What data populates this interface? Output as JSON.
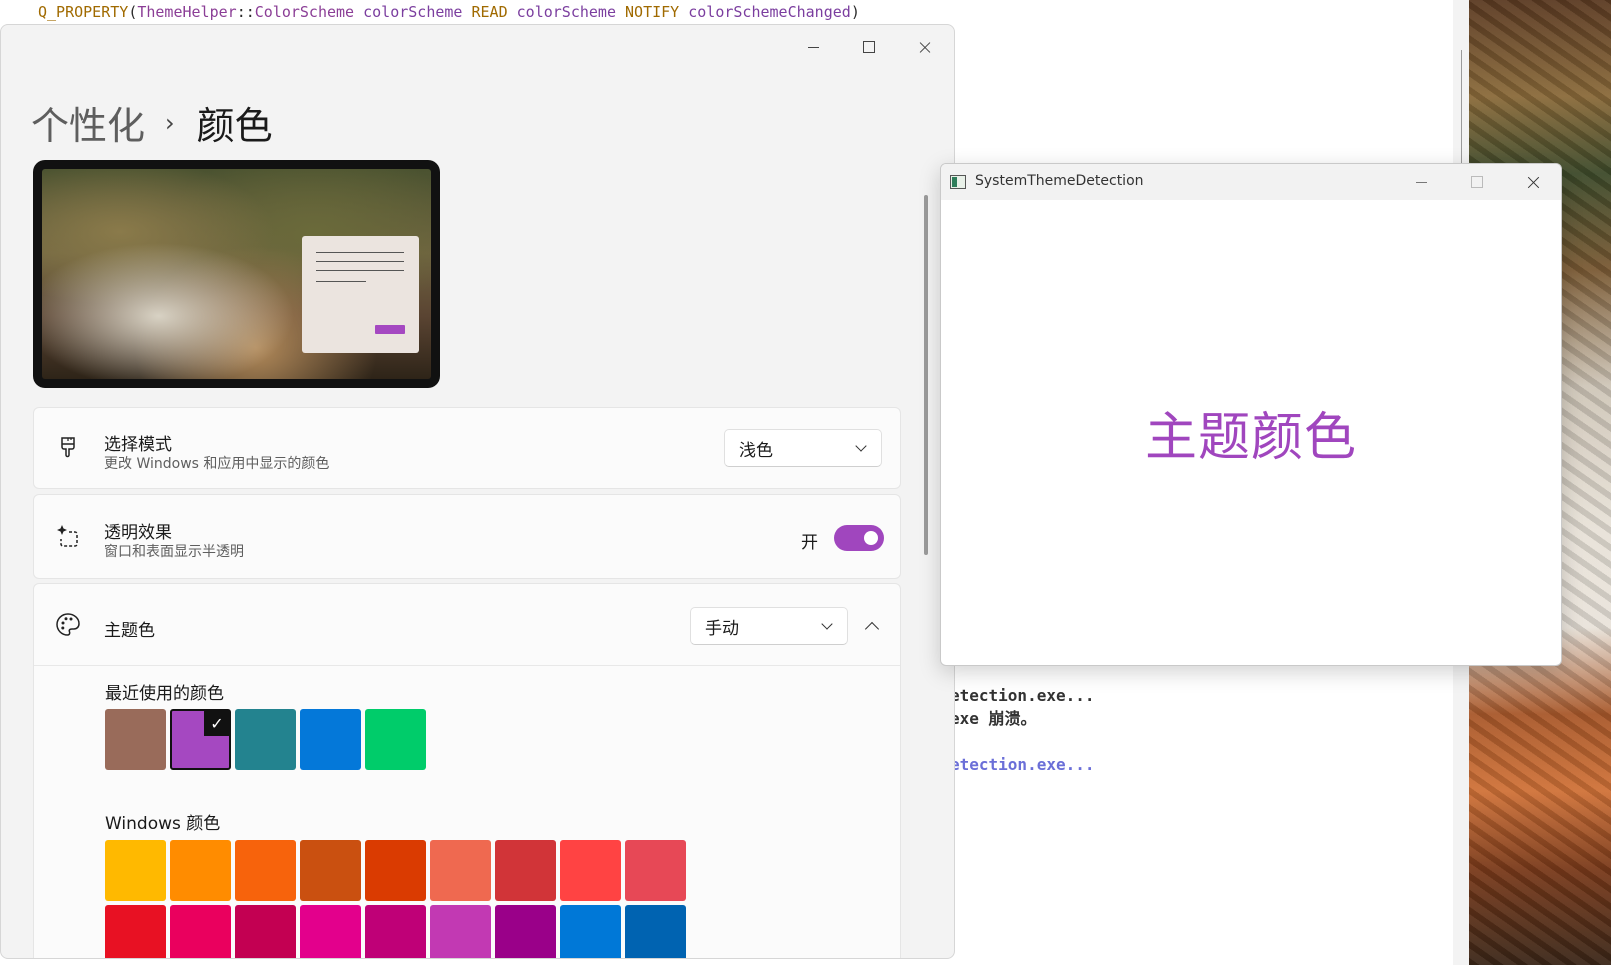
{
  "ide": {
    "code_line": {
      "macro": "Q_PROPERTY",
      "open": "(",
      "type_ns": "ThemeHelper",
      "scope": "::",
      "type_name": "ColorScheme",
      "var1": "colorScheme",
      "kw_read": "READ",
      "var2": "colorScheme",
      "kw_notify": "NOTIFY",
      "signal": "colorSchemeChanged",
      "close": ")"
    },
    "output_lines": [
      "etection.exe...",
      "exe 崩溃。",
      "",
      "etection.exe..."
    ]
  },
  "settings": {
    "breadcrumb": {
      "parent": "个性化",
      "separator": "›",
      "current": "颜色"
    },
    "mode": {
      "title": "选择模式",
      "subtitle": "更改 Windows 和应用中显示的颜色",
      "value": "浅色"
    },
    "transparency": {
      "title": "透明效果",
      "subtitle": "窗口和表面显示半透明",
      "state_label": "开",
      "on": true
    },
    "accent": {
      "title": "主题色",
      "value": "手动"
    },
    "recent_label": "最近使用的颜色",
    "recent_colors": [
      "#996b5a",
      "#a548c1",
      "#23838f",
      "#0478d9",
      "#00cc6a"
    ],
    "recent_selected": 1,
    "windows_label": "Windows 颜色",
    "windows_colors_row1": [
      "#ffb900",
      "#ff8c00",
      "#f7630c",
      "#ca5010",
      "#da3b01",
      "#ef6950",
      "#d13438",
      "#ff4343",
      "#e74856"
    ],
    "windows_colors_row2": [
      "#e81123",
      "#ea005e",
      "#c30052",
      "#e3008c",
      "#bf0077",
      "#c239b3",
      "#9a0089",
      "#0078d7",
      "#0063b1"
    ],
    "accent_color": "#a046be"
  },
  "qtwin": {
    "title": "SystemThemeDetection",
    "theme_text": "主题颜色"
  }
}
